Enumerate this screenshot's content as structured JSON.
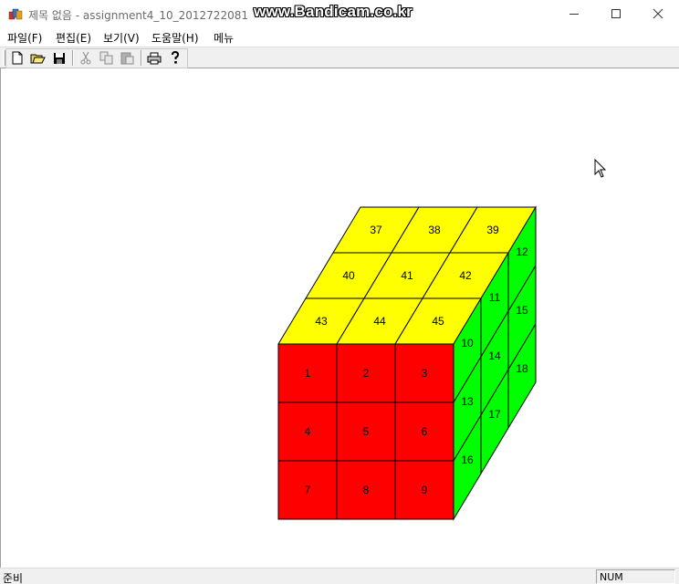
{
  "window": {
    "title": "제목 없음 - assignment4_10_2012722081",
    "watermark": "www.Bandicam.co.kr",
    "controls": [
      "minimize-icon",
      "maximize-icon",
      "close-icon"
    ]
  },
  "menu": [
    "파일(F)",
    "편집(E)",
    "보기(V)",
    "도움말(H)",
    "메뉴"
  ],
  "toolbar": {
    "buttons": [
      "new-file-icon",
      "open-folder-icon",
      "save-disk-icon",
      "cut-icon",
      "copy-icon",
      "paste-icon",
      "print-icon",
      "help-icon"
    ]
  },
  "cube": {
    "colors": {
      "front": "#ff0000",
      "right": "#00ff00",
      "top": "#ffff00",
      "edge": "#000000"
    },
    "front": [
      "1",
      "2",
      "3",
      "4",
      "5",
      "6",
      "7",
      "8",
      "9"
    ],
    "right": [
      "10",
      "11",
      "12",
      "13",
      "14",
      "15",
      "16",
      "17",
      "18"
    ],
    "top": [
      "37",
      "38",
      "39",
      "40",
      "41",
      "42",
      "43",
      "44",
      "45"
    ]
  },
  "status": {
    "text": "준비",
    "num": "NUM"
  }
}
